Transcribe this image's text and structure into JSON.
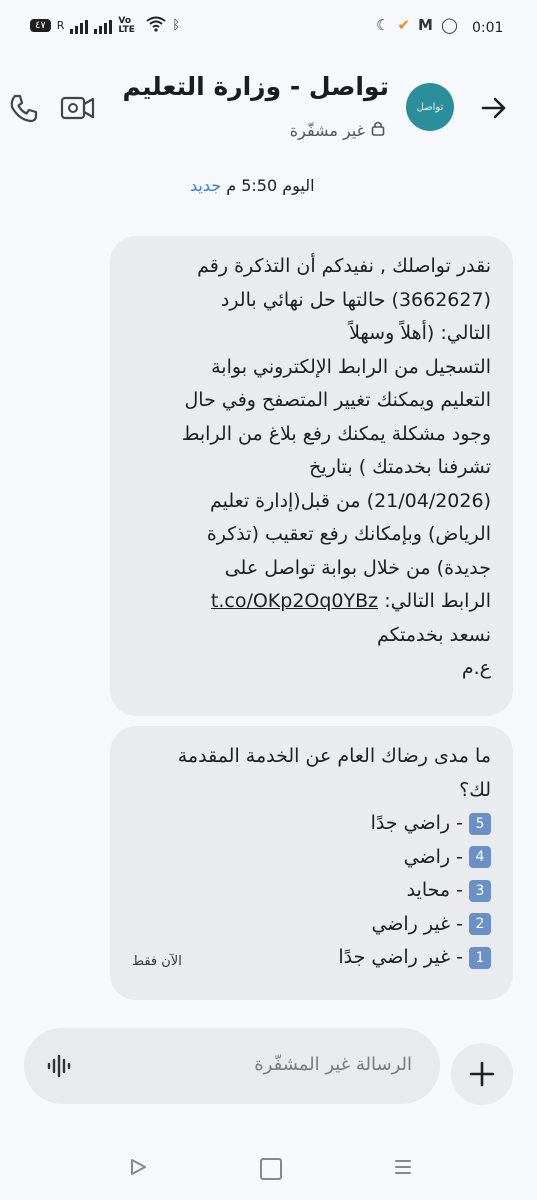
{
  "status_bar": {
    "time": "0:01",
    "badge": "٤٧",
    "roaming": "R",
    "volte": "Vo LTE",
    "indicators": [
      "moon-icon",
      "lightning-icon",
      "orange-app-icon",
      "mail-icon",
      "whatsapp-icon"
    ]
  },
  "header": {
    "title": "تواصل - وزارة التعليم",
    "subtitle": "غير مشفّرة",
    "avatar_text": "تواصل"
  },
  "timestamp": {
    "day_time": "اليوم 5:50 م",
    "new_label": "جديد"
  },
  "messages": [
    {
      "lines": [
        "نقدر تواصلك , نفيدكم أن التذكرة رقم",
        "(3662627) حالتها حل نهائي بالرد",
        "التالي: (أهلاً وسهلاً",
        "التسجيل من الرابط الإلكتروني بوابة",
        "التعليم ويمكنك تغيير المتصفح وفي حال",
        "وجود مشكلة يمكنك رفع بلاغ من الرابط",
        "تشرفنا بخدمتك ) بتاريخ",
        "(21/04/2026) من قبل(إدارة تعليم",
        "الرياض) وبإمكانك رفع تعقيب (تذكرة",
        "جديدة) من خلال بوابة تواصل على"
      ],
      "link_prefix": "الرابط التالي:",
      "link": "t.co/OKp2Oq0YBz",
      "closing": [
        "نسعد بخدمتكم",
        "ع.م"
      ]
    },
    {
      "question": [
        "ما مدى رضاك العام عن الخدمة المقدمة",
        "لك؟"
      ],
      "options": [
        {
          "key": "5",
          "label": "- راضي جدًا"
        },
        {
          "key": "4",
          "label": "- راضي"
        },
        {
          "key": "3",
          "label": "- محايد"
        },
        {
          "key": "2",
          "label": "- غير راضي"
        },
        {
          "key": "1",
          "label": "- غير راضي جدًا"
        }
      ],
      "time": "الآن فقط"
    }
  ],
  "compose": {
    "placeholder": "الرسالة غير المشفّرة"
  },
  "colors": {
    "bubble": "#e9ebef",
    "accent": "#3b7dd8",
    "avatar": "#2a8f9b",
    "key": "#6a90c8"
  }
}
